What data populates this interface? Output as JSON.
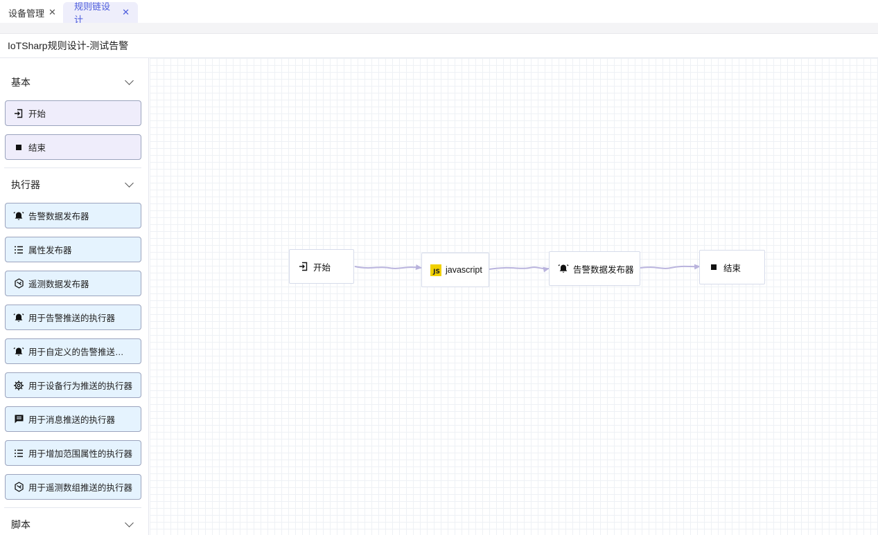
{
  "tabs": [
    {
      "label": "设备管理",
      "active": false
    },
    {
      "label": "规则链设计",
      "active": true
    }
  ],
  "page_title": "IoTSharp规则设计-测试告警",
  "sidebar": {
    "groups": {
      "basic": {
        "title": "基本",
        "items": [
          {
            "label": "开始",
            "icon": "enter-icon"
          },
          {
            "label": "结束",
            "icon": "stop-icon"
          }
        ]
      },
      "executors": {
        "title": "执行器",
        "items": [
          {
            "label": "告警数据发布器",
            "icon": "alarm-bell-icon"
          },
          {
            "label": "属性发布器",
            "icon": "list-icon"
          },
          {
            "label": "遥测数据发布器",
            "icon": "telemetry-icon"
          },
          {
            "label": "用于告警推送的执行器",
            "icon": "alarm-bell-icon"
          },
          {
            "label": "用于自定义的告警推送的执行器",
            "icon": "alarm-bell-icon"
          },
          {
            "label": "用于设备行为推送的执行器",
            "icon": "chip-icon"
          },
          {
            "label": "用于消息推送的执行器",
            "icon": "message-icon"
          },
          {
            "label": "用于增加范围属性的执行器",
            "icon": "list-icon"
          },
          {
            "label": "用于遥测数组推送的执行器",
            "icon": "telemetry-icon"
          }
        ]
      },
      "script": {
        "title": "脚本"
      }
    }
  },
  "flow": {
    "nodes": [
      {
        "label": "开始",
        "icon": "enter-icon"
      },
      {
        "label": "javascript",
        "icon": "javascript-icon",
        "badge": "JS"
      },
      {
        "label": "告警数据发布器",
        "icon": "alarm-bell-icon"
      },
      {
        "label": "结束",
        "icon": "stop-icon"
      }
    ],
    "edge_color": "#b9b3dd"
  },
  "colors": {
    "accent": "#4b5bdc",
    "basic_item_bg": "#efedfb",
    "executor_item_bg": "#e5f3fe",
    "js_yellow": "#f0d000"
  }
}
